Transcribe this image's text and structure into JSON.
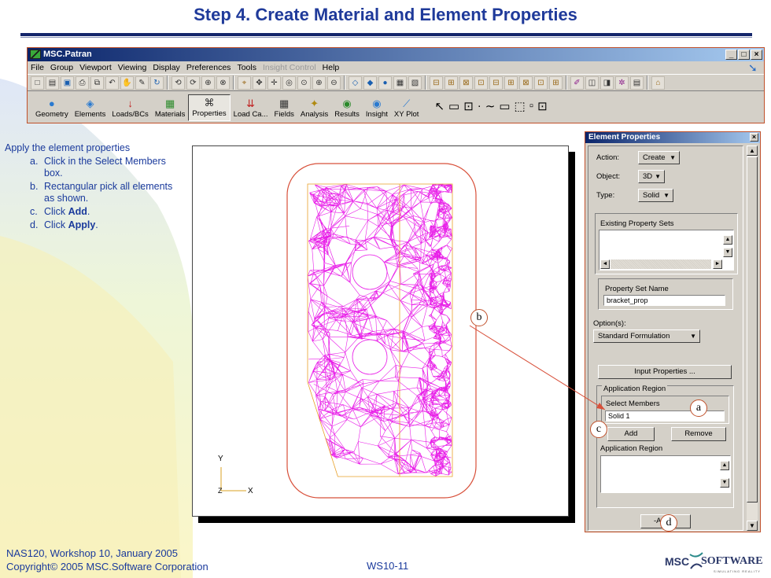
{
  "slide": {
    "title": "Step 4. Create Material and Element Properties",
    "footer_line1": "NAS120, Workshop 10, January 2005",
    "footer_line2": "Copyright© 2005 MSC.Software Corporation",
    "page_id": "WS10-11",
    "logo_msc": "MSC",
    "logo_software": "SOFTWARE",
    "logo_tagline": "SIMULATING REALITY"
  },
  "window": {
    "title": "MSC.Patran",
    "minimize": "_",
    "maximize": "□",
    "close": "×"
  },
  "menu": [
    "File",
    "Group",
    "Viewport",
    "Viewing",
    "Display",
    "Preferences",
    "Tools",
    "Insight Control",
    "Help"
  ],
  "menu_disabled_index": 7,
  "app_buttons": [
    {
      "label": "Geometry",
      "icon": "●",
      "color": "#2a7ad0"
    },
    {
      "label": "Elements",
      "icon": "◈",
      "color": "#2a7ad0"
    },
    {
      "label": "Loads/BCs",
      "icon": "↓",
      "color": "#c02020"
    },
    {
      "label": "Materials",
      "icon": "▦",
      "color": "#2a8a2a"
    },
    {
      "label": "Properties",
      "icon": "⌘",
      "color": "#333333"
    },
    {
      "label": "Load Ca...",
      "icon": "⇊",
      "color": "#c02020"
    },
    {
      "label": "Fields",
      "icon": "▦",
      "color": "#333333"
    },
    {
      "label": "Analysis",
      "icon": "✦",
      "color": "#b08a10"
    },
    {
      "label": "Results",
      "icon": "◉",
      "color": "#2a8a2a"
    },
    {
      "label": "Insight",
      "icon": "◉",
      "color": "#2a7ad0"
    },
    {
      "label": "XY Plot",
      "icon": "⟋",
      "color": "#2a7ad0"
    }
  ],
  "active_app_index": 4,
  "instructions": {
    "intro": "Apply the element properties",
    "steps": [
      {
        "letter": "a.",
        "text": "Click in the Select Members box."
      },
      {
        "letter": "b.",
        "text": "Rectangular pick all elements as shown."
      },
      {
        "letter": "c.",
        "text": "Click ",
        "bold": "Add",
        "after": "."
      },
      {
        "letter": "d.",
        "text": "Click ",
        "bold": "Apply",
        "after": "."
      }
    ]
  },
  "viewport": {
    "axis_y": "Y",
    "axis_x": "X",
    "axis_z": "Z",
    "mesh_color": "#e81ee8"
  },
  "form": {
    "title": "Element Properties",
    "close": "×",
    "action_label": "Action:",
    "action_value": "Create",
    "object_label": "Object:",
    "object_value": "3D",
    "type_label": "Type:",
    "type_value": "Solid",
    "existing_sets_label": "Existing Property Sets",
    "property_set_name_label": "Property Set Name",
    "property_set_name_value": "bracket_prop",
    "options_label": "Option(s):",
    "options_value": "Standard Formulation",
    "input_properties": "Input Properties ...",
    "app_region_group": "Application Region",
    "select_members_label": "Select Members",
    "select_members_value": "Solid 1",
    "add": "Add",
    "remove": "Remove",
    "app_region_list_label": "Application Region",
    "apply": "-Apply-"
  },
  "callouts": {
    "a": "a",
    "b": "b",
    "c": "c",
    "d": "d"
  },
  "colors": {
    "title_blue": "#1f3a9a",
    "callout_line": "#d8503a",
    "mesh": "#e81ee8",
    "mesh_outline": "#e8a028"
  }
}
